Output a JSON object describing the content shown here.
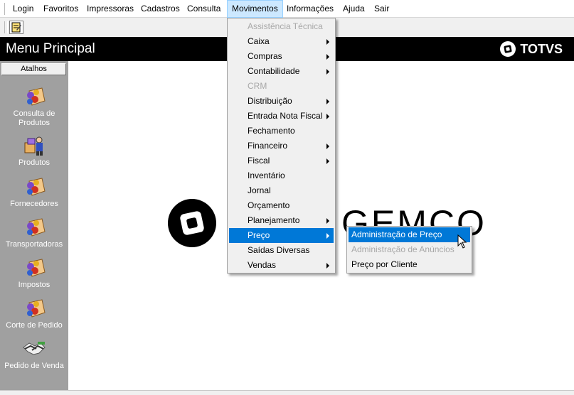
{
  "menubar": {
    "items": [
      "Login",
      "Favoritos",
      "Impressoras",
      "Cadastros",
      "Consulta",
      "Movimentos",
      "Informações",
      "Ajuda",
      "Sair"
    ]
  },
  "header": {
    "title": "Menu Principal",
    "brand": "TOTVS"
  },
  "sidebar": {
    "tab_label": "Atalhos",
    "shortcuts": [
      "Consulta de Produtos",
      "Produtos",
      "Fornecedores",
      "Transportadoras",
      "Impostos",
      "Corte de Pedido",
      "Pedido de Venda"
    ]
  },
  "watermark": {
    "text": "GEMCO"
  },
  "movimentos_menu": {
    "items": [
      {
        "label": "Assistência Técnica"
      },
      {
        "label": "Caixa"
      },
      {
        "label": "Compras"
      },
      {
        "label": "Contabilidade"
      },
      {
        "label": "CRM"
      },
      {
        "label": "Distribuição"
      },
      {
        "label": "Entrada Nota Fiscal"
      },
      {
        "label": "Fechamento"
      },
      {
        "label": "Financeiro"
      },
      {
        "label": "Fiscal"
      },
      {
        "label": "Inventário"
      },
      {
        "label": "Jornal"
      },
      {
        "label": "Orçamento"
      },
      {
        "label": "Planejamento"
      },
      {
        "label": "Preço"
      },
      {
        "label": "Saídas Diversas"
      },
      {
        "label": "Vendas"
      }
    ]
  },
  "preco_submenu": {
    "items": [
      {
        "label": "Administração de Preço"
      },
      {
        "label": "Administração de Anúncios"
      },
      {
        "label": "Preço por Cliente"
      }
    ]
  },
  "colors": {
    "selection": "#0078d7",
    "sidebar": "#a0a0a0",
    "header": "#000000"
  }
}
